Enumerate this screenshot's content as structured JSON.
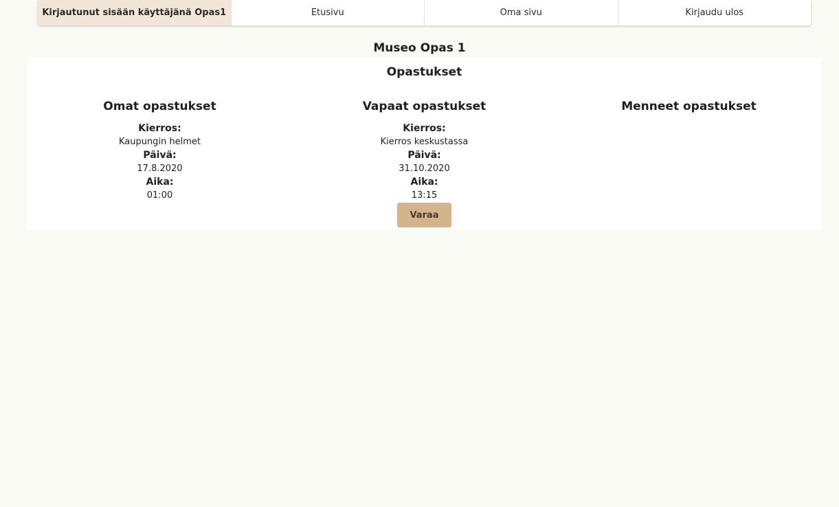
{
  "nav": {
    "logged_in": "Kirjautunut sisään käyttäjänä Opas1",
    "home": "Etusivu",
    "my_page": "Oma sivu",
    "logout": "Kirjaudu ulos"
  },
  "museum_title": "Museo Opas 1",
  "section_title": "Opastukset",
  "columns": {
    "own": {
      "title": "Omat opastukset",
      "tour_label": "Kierros:",
      "tour": "Kaupungin helmet",
      "date_label": "Päivä:",
      "date": "17.8.2020",
      "time_label": "Aika:",
      "time": "01:00"
    },
    "free": {
      "title": "Vapaat opastukset",
      "tour_label": "Kierros:",
      "tour": "Kierros keskustassa",
      "date_label": "Päivä:",
      "date": "31.10.2020",
      "time_label": "Aika:",
      "time": "13:15",
      "button": "Varaa"
    },
    "past": {
      "title": "Menneet opastukset"
    }
  },
  "colors": {
    "background": "#fafaf4",
    "nav_active": "#f2e6d8",
    "button": "#d4b48c"
  }
}
